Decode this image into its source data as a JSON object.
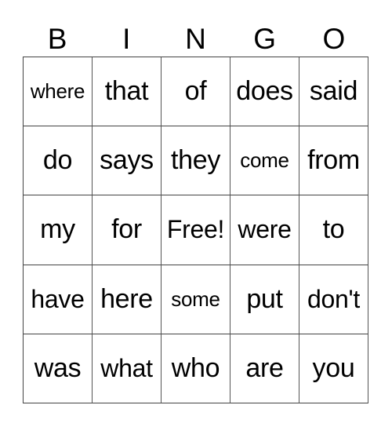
{
  "card": {
    "header": [
      "B",
      "I",
      "N",
      "G",
      "O"
    ],
    "rows": [
      [
        "where",
        "that",
        "of",
        "does",
        "said"
      ],
      [
        "do",
        "says",
        "they",
        "come",
        "from"
      ],
      [
        "my",
        "for",
        "Free!",
        "were",
        "to"
      ],
      [
        "have",
        "here",
        "some",
        "put",
        "don't"
      ],
      [
        "was",
        "what",
        "who",
        "are",
        "you"
      ]
    ],
    "free_space": "Free!"
  }
}
